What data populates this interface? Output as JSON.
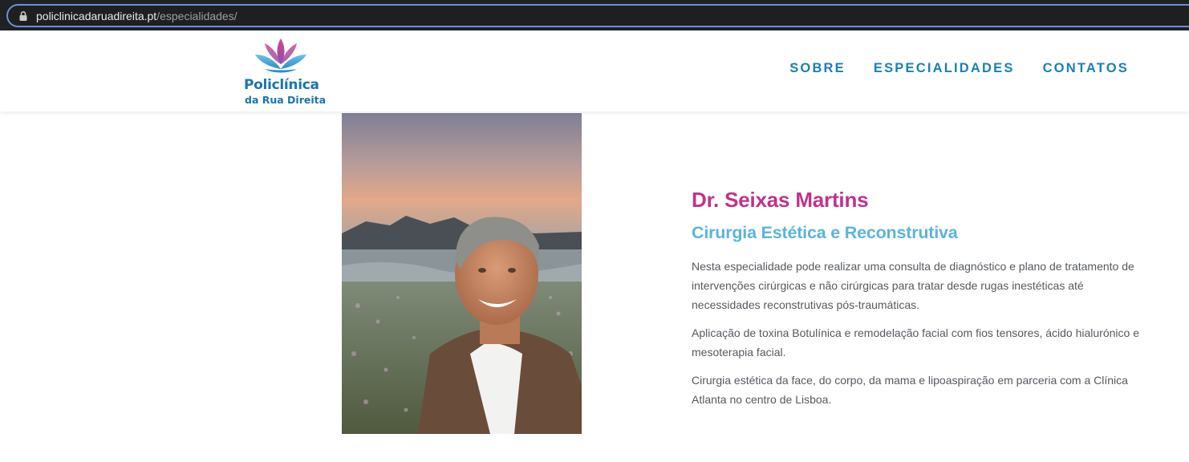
{
  "browser": {
    "url_host": "policlinicadaruadireita.pt",
    "url_path": "/especialidades/"
  },
  "header": {
    "logo_line1": "Policlínica",
    "logo_line2": "da Rua Direita",
    "nav": [
      "SOBRE",
      "ESPECIALIDADES",
      "CONTATOS"
    ]
  },
  "doctor": {
    "name": "Dr. Seixas Martins",
    "specialty": "Cirurgia Estética e Reconstrutiva",
    "paragraphs": [
      "Nesta especialidade pode realizar uma consulta de diagnóstico e plano de tratamento de intervenções cirúrgicas e não cirúrgicas para tratar desde rugas inestéticas até necessidades reconstrutivas pós-traumáticas.",
      "Aplicação de toxina Botulínica e remodelação facial com fios tensores, ácido hialurónico e mesoterapia facial.",
      "Cirurgia estética da face, do corpo, da mama e lipoaspiração em parceria com a Clínica Atlanta no centro de Lisboa."
    ]
  },
  "colors": {
    "brand_blue": "#1a74ad",
    "nav_blue": "#1a7fb5",
    "name_magenta": "#c0338c",
    "specialty_blue": "#5cb4dc",
    "body_text": "#555a5f"
  }
}
